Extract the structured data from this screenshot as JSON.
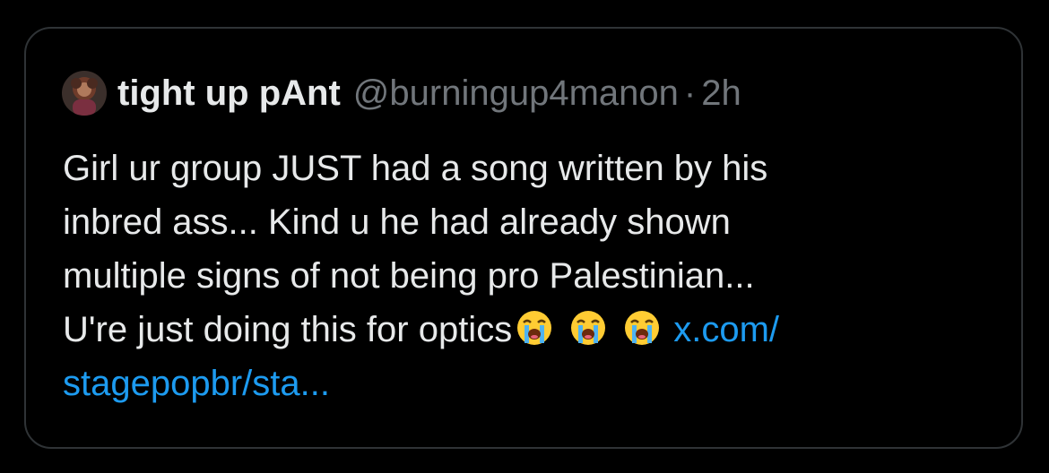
{
  "tweet": {
    "author": {
      "display_name": "tight up pAnt",
      "handle": "@burningup4manon",
      "avatar_icon": "profile-avatar"
    },
    "separator": "·",
    "time": "2h",
    "lines": [
      "Girl ur group JUST had a song written by his",
      "inbred ass... Kind u he had already shown",
      "multiple signs of not being pro Palestinian...",
      "U're just doing this for optics"
    ],
    "emoji_icon": "loudly-crying-face-emoji",
    "link_part1": "x.com/",
    "link_part2": "stagepopbr/sta..."
  },
  "colors": {
    "background": "#000000",
    "border": "#2f3336",
    "text_primary": "#e7e9ea",
    "text_secondary": "#71767b",
    "link": "#1d9bf0"
  }
}
